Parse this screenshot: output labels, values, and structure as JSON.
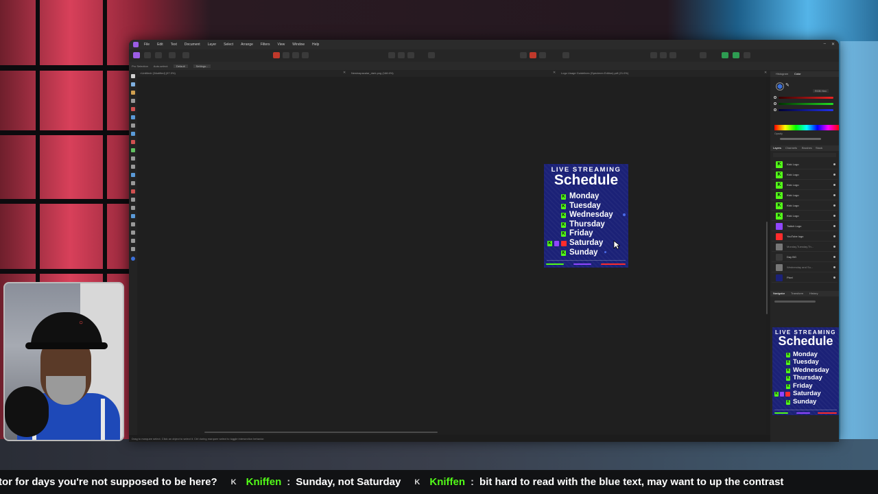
{
  "app": {
    "menu": [
      "File",
      "Edit",
      "Text",
      "Document",
      "Layer",
      "Select",
      "Arrange",
      "Filters",
      "View",
      "Window",
      "Help"
    ],
    "context_bar": {
      "tool": "Pro Selection",
      "auto_select_label": "Auto-select:",
      "auto_select_value": "Default",
      "settings_label": "Settings..."
    },
    "tabs": [
      {
        "label": "<Untitled> [Modified] (97.0%)"
      },
      {
        "label": "Newinapacalar_dark.png (168.6%)"
      },
      {
        "label": "Logo Usage Guidelines (Specimen Edition).pdf (21.0%)"
      }
    ],
    "status_text": "Drag to marquee select. Click an object to select it. Ctrl during marquee select to toggle intersection behavior."
  },
  "schedule": {
    "header_top": "LIVE STREAMING",
    "header_main": "Schedule",
    "days": [
      "Monday",
      "Tuesday",
      "Wednesday",
      "Thursday",
      "Friday",
      "Saturday",
      "Sunday"
    ],
    "kick_glyph": "K"
  },
  "panels": {
    "color_tabs": [
      "Histogram",
      "Color"
    ],
    "color_mode": "RGB Hex",
    "opacity_label": "Opacity",
    "layer_tabs": [
      "Layers",
      "Channels",
      "Brushes",
      "Stock"
    ],
    "layers": [
      {
        "name": "Kick Logo",
        "thumb": "kick"
      },
      {
        "name": "Kick Logo",
        "thumb": "kick"
      },
      {
        "name": "Kick Logo",
        "thumb": "kick"
      },
      {
        "name": "Kick Logo",
        "thumb": "kick"
      },
      {
        "name": "Kick Logo",
        "thumb": "kick"
      },
      {
        "name": "Kick Logo",
        "thumb": "kick"
      },
      {
        "name": "Twitch Logo",
        "thumb": "twitch"
      },
      {
        "name": "YouTube logo",
        "thumb": "youtube"
      },
      {
        "name": "Monday,Tuesday,Th...",
        "thumb": "text"
      },
      {
        "name": "Day BG",
        "thumb": "dark"
      },
      {
        "name": "Wednesday and Su...",
        "thumb": "text"
      },
      {
        "name": "Pixel",
        "thumb": "blue"
      }
    ],
    "nav_tabs": [
      "Navigator",
      "Transform",
      "History"
    ]
  },
  "chat": [
    {
      "user": "",
      "message": "tor for days you're not supposed to be here?"
    },
    {
      "user": "Kniffen",
      "message": "Sunday, not Saturday"
    },
    {
      "user": "Kniffen",
      "message": "bit hard to read with the blue text, may want to up the contrast"
    }
  ],
  "colors": {
    "accent": "#9b5de5",
    "kick_green": "#53fc18",
    "schedule_bg": "#1b2177",
    "twitch": "#9146ff",
    "youtube": "#ff2c2c"
  }
}
